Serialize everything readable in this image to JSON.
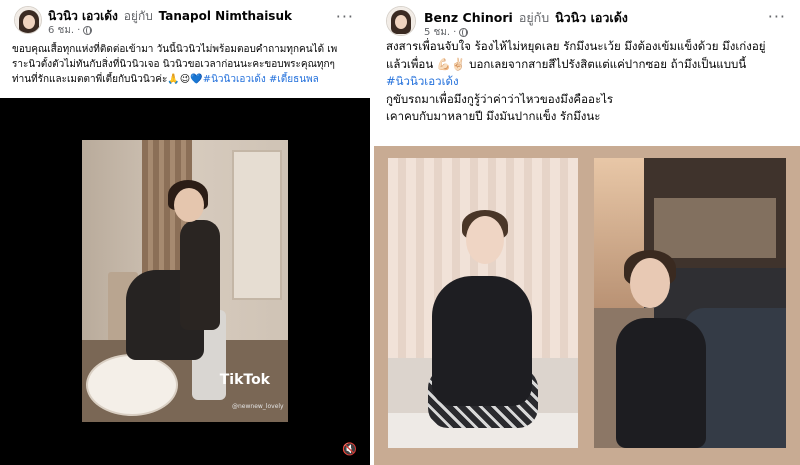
{
  "left_post": {
    "author": "นิวนิว เอวเด้ง",
    "at_label": "อยู่กับ",
    "with_name": "Tanapol Nimthaisuk",
    "time": "6 ชม.",
    "sep": "·",
    "more": "···",
    "caption_lines": [
      "ขอบคุณเสื้อทุกแห่งที่ติดต่อเข้ามา วันนี้นิวนิวไม่พร้อมตอบคำถามทุกคนได้ เพ",
      "ราะนิวตั้งตัวไม่ทันกับสิ่งที่นิวนิวเจอ นิวนิวขอเวลาก่อนนะคะขอบพระคุณทุกๆ",
      "ท่านที่รักและเมตตาพี่เตี้ยกับนิวนิวค่ะ🙏😉💙"
    ],
    "hashtags": "#นิวนิวเอวเด้ง #เตี้ยธนพล",
    "video": {
      "watermark": "TikTok",
      "handle": "@newnew_lovely",
      "mute_icon": "🔇"
    }
  },
  "right_post": {
    "author": "Benz Chinori",
    "at_label": "อยู่กับ",
    "with_name": "นิวนิว เอวเด้ง",
    "time": "5 ชม.",
    "sep": "·",
    "more": "···",
    "caption_lines": [
      "สงสารเพื่อนจับใจ ร้องไห้ไม่หยุดเลย รักมึงนะเว้ย มึงต้องเข้มแข็งด้วย มึงเก่งอยู่",
      "แล้วเพื่อน 💪🏻✌🏻 บอกเลยจากสายสีไปรังสิตแต่แค่ปากซอย ถ้ามึงเป็นแบบนี้",
      "#นิวนิวเอวเด้ง",
      "กูขับรถมาเพื่อมึงกูรู้ว่าค่าว่าไหวของมึงคืออะไร",
      "เคาคบกับมาหลายปี มึงมันปากแข็ง รักมึงนะ"
    ]
  }
}
